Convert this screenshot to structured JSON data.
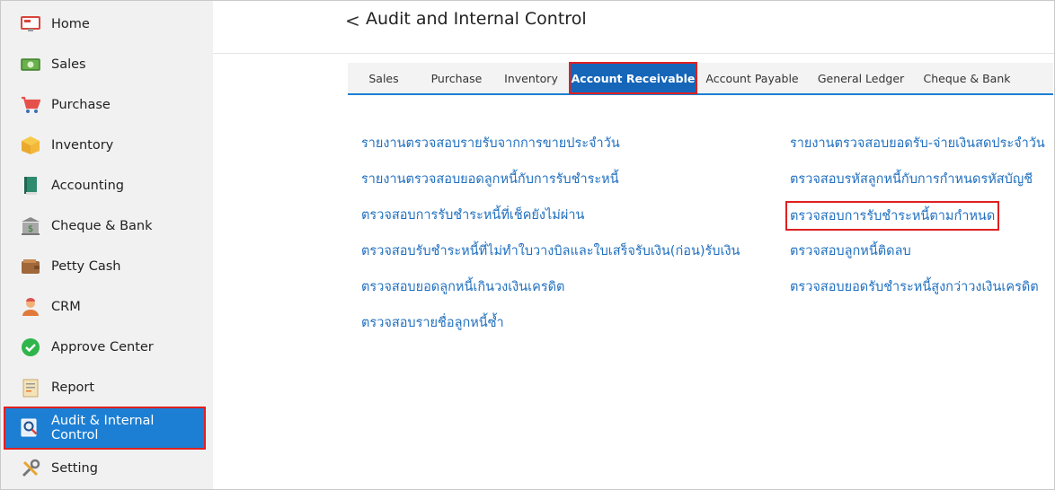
{
  "sidebar": {
    "items": [
      {
        "label": "Home",
        "icon": "monitor-icon"
      },
      {
        "label": "Sales",
        "icon": "banknote-icon"
      },
      {
        "label": "Purchase",
        "icon": "cart-icon"
      },
      {
        "label": "Inventory",
        "icon": "box-icon"
      },
      {
        "label": "Accounting",
        "icon": "ledger-book-icon"
      },
      {
        "label": "Cheque & Bank",
        "icon": "bank-icon"
      },
      {
        "label": "Petty Cash",
        "icon": "wallet-icon"
      },
      {
        "label": "CRM",
        "icon": "people-icon"
      },
      {
        "label": "Approve Center",
        "icon": "check-circle-icon"
      },
      {
        "label": "Report",
        "icon": "report-icon"
      },
      {
        "label": "Audit & Internal Control",
        "icon": "audit-search-icon"
      },
      {
        "label": "Setting",
        "icon": "tools-icon"
      }
    ],
    "active_index": 10
  },
  "header": {
    "back_glyph": "<",
    "title": "Audit and Internal Control"
  },
  "tabs": [
    {
      "label": "Sales"
    },
    {
      "label": "Purchase"
    },
    {
      "label": "Inventory"
    },
    {
      "label": "Account Receivable"
    },
    {
      "label": "Account Payable"
    },
    {
      "label": "General Ledger"
    },
    {
      "label": "Cheque & Bank"
    }
  ],
  "active_tab": "Account Receivable",
  "reports": {
    "left": [
      "รายงานตรวจสอบรายรับจากการขายประจำวัน",
      "รายงานตรวจสอบยอดลูกหนี้กับการรับชำระหนี้",
      "ตรวจสอบการรับชำระหนี้ที่เช็คยังไม่ผ่าน",
      "ตรวจสอบรับชำระหนี้ที่ไม่ทำใบวางบิลและใบเสร็จรับเงิน(ก่อน)รับเงิน",
      "ตรวจสอบยอดลูกหนี้เกินวงเงินเครดิต",
      "ตรวจสอบรายชื่อลูกหนี้ซ้ำ"
    ],
    "right": [
      "รายงานตรวจสอบยอดรับ-จ่ายเงินสดประจำวัน",
      "ตรวจสอบรหัสลูกหนี้กับการกำหนดรหัสบัญชี",
      "ตรวจสอบการรับชำระหนี้ตามกำหนด",
      "ตรวจสอบลูกหนี้ติดลบ",
      "ตรวจสอบยอดรับชำระหนี้สูงกว่าวงเงินเครดิต"
    ],
    "highlighted": "ตรวจสอบการรับชำระหนี้ตามกำหนด"
  },
  "colors": {
    "accent": "#1c7fd4",
    "highlight_border": "#e02020",
    "link": "#1f6fbf",
    "sidebar_bg": "#f1f1f1"
  }
}
